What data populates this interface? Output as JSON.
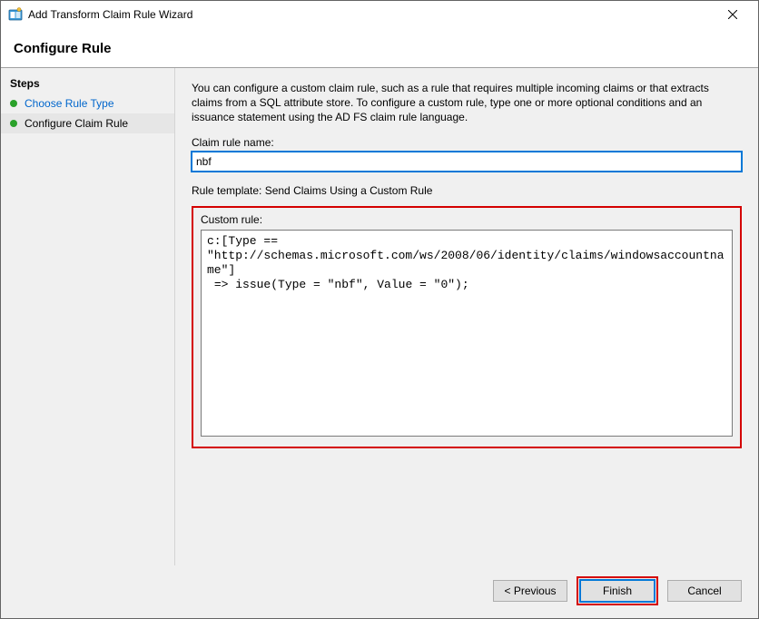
{
  "window": {
    "title": "Add Transform Claim Rule Wizard"
  },
  "header": {
    "title": "Configure Rule"
  },
  "sidebar": {
    "steps_header": "Steps",
    "items": [
      {
        "label": "Choose Rule Type"
      },
      {
        "label": "Configure Claim Rule"
      }
    ]
  },
  "main": {
    "description": "You can configure a custom claim rule, such as a rule that requires multiple incoming claims or that extracts claims from a SQL attribute store. To configure a custom rule, type one or more optional conditions and an issuance statement using the AD FS claim rule language.",
    "claim_rule_name_label": "Claim rule name:",
    "claim_rule_name_value": "nbf",
    "rule_template_text": "Rule template: Send Claims Using a Custom Rule",
    "custom_rule_label": "Custom rule:",
    "custom_rule_value": "c:[Type == \"http://schemas.microsoft.com/ws/2008/06/identity/claims/windowsaccountname\"]\n => issue(Type = \"nbf\", Value = \"0\");"
  },
  "buttons": {
    "previous": "< Previous",
    "finish": "Finish",
    "cancel": "Cancel"
  }
}
